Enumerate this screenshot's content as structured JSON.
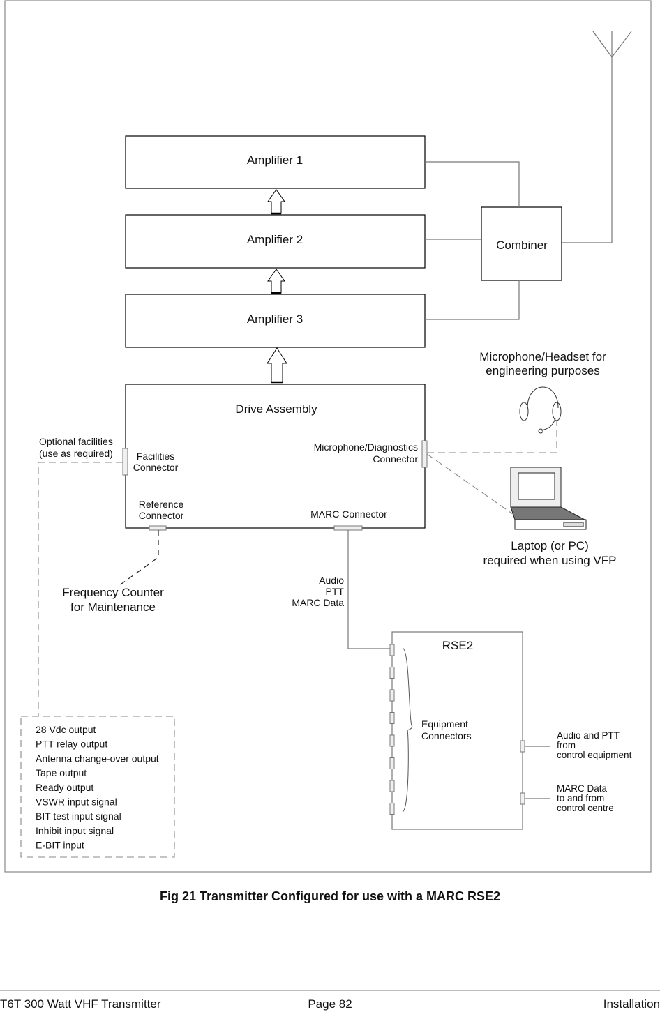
{
  "figure": {
    "caption": "Fig 21  Transmitter Configured for use with a MARC RSE2"
  },
  "blocks": {
    "amp1": "Amplifier 1",
    "amp2": "Amplifier 2",
    "amp3": "Amplifier 3",
    "combiner": "Combiner",
    "drive": "Drive Assembly",
    "rse2": "RSE2"
  },
  "drive_connectors": {
    "facilities": [
      "Facilities",
      "Connector"
    ],
    "mic_diag": [
      "Microphone/Diagnostics",
      "Connector"
    ],
    "reference": [
      "Reference",
      "Connector"
    ],
    "marc": "MARC Connector"
  },
  "labels": {
    "optional_facilities": [
      "Optional facilities",
      "(use as required)"
    ],
    "headset": [
      "Microphone/Headset for",
      "engineering purposes"
    ],
    "laptop": [
      "Laptop (or PC)",
      "required when using VFP"
    ],
    "freq_counter": [
      "Frequency Counter",
      "for Maintenance"
    ],
    "marc_signals": [
      "Audio",
      "PTT",
      "MARC Data"
    ],
    "equipment_connectors": [
      "Equipment",
      "Connectors"
    ],
    "audio_ptt": [
      "Audio and PTT",
      "from",
      "control equipment"
    ],
    "marc_data": [
      "MARC Data",
      "to and from",
      "control centre"
    ]
  },
  "facilities_list": [
    "28 Vdc output",
    "PTT relay output",
    "Antenna change-over output",
    "Tape output",
    "Ready output",
    "VSWR input signal",
    "BIT test input signal",
    "Inhibit input signal",
    "E-BIT input"
  ],
  "footer": {
    "left": "T6T 300 Watt VHF Transmitter",
    "center": "Page 82",
    "right": "Installation"
  }
}
